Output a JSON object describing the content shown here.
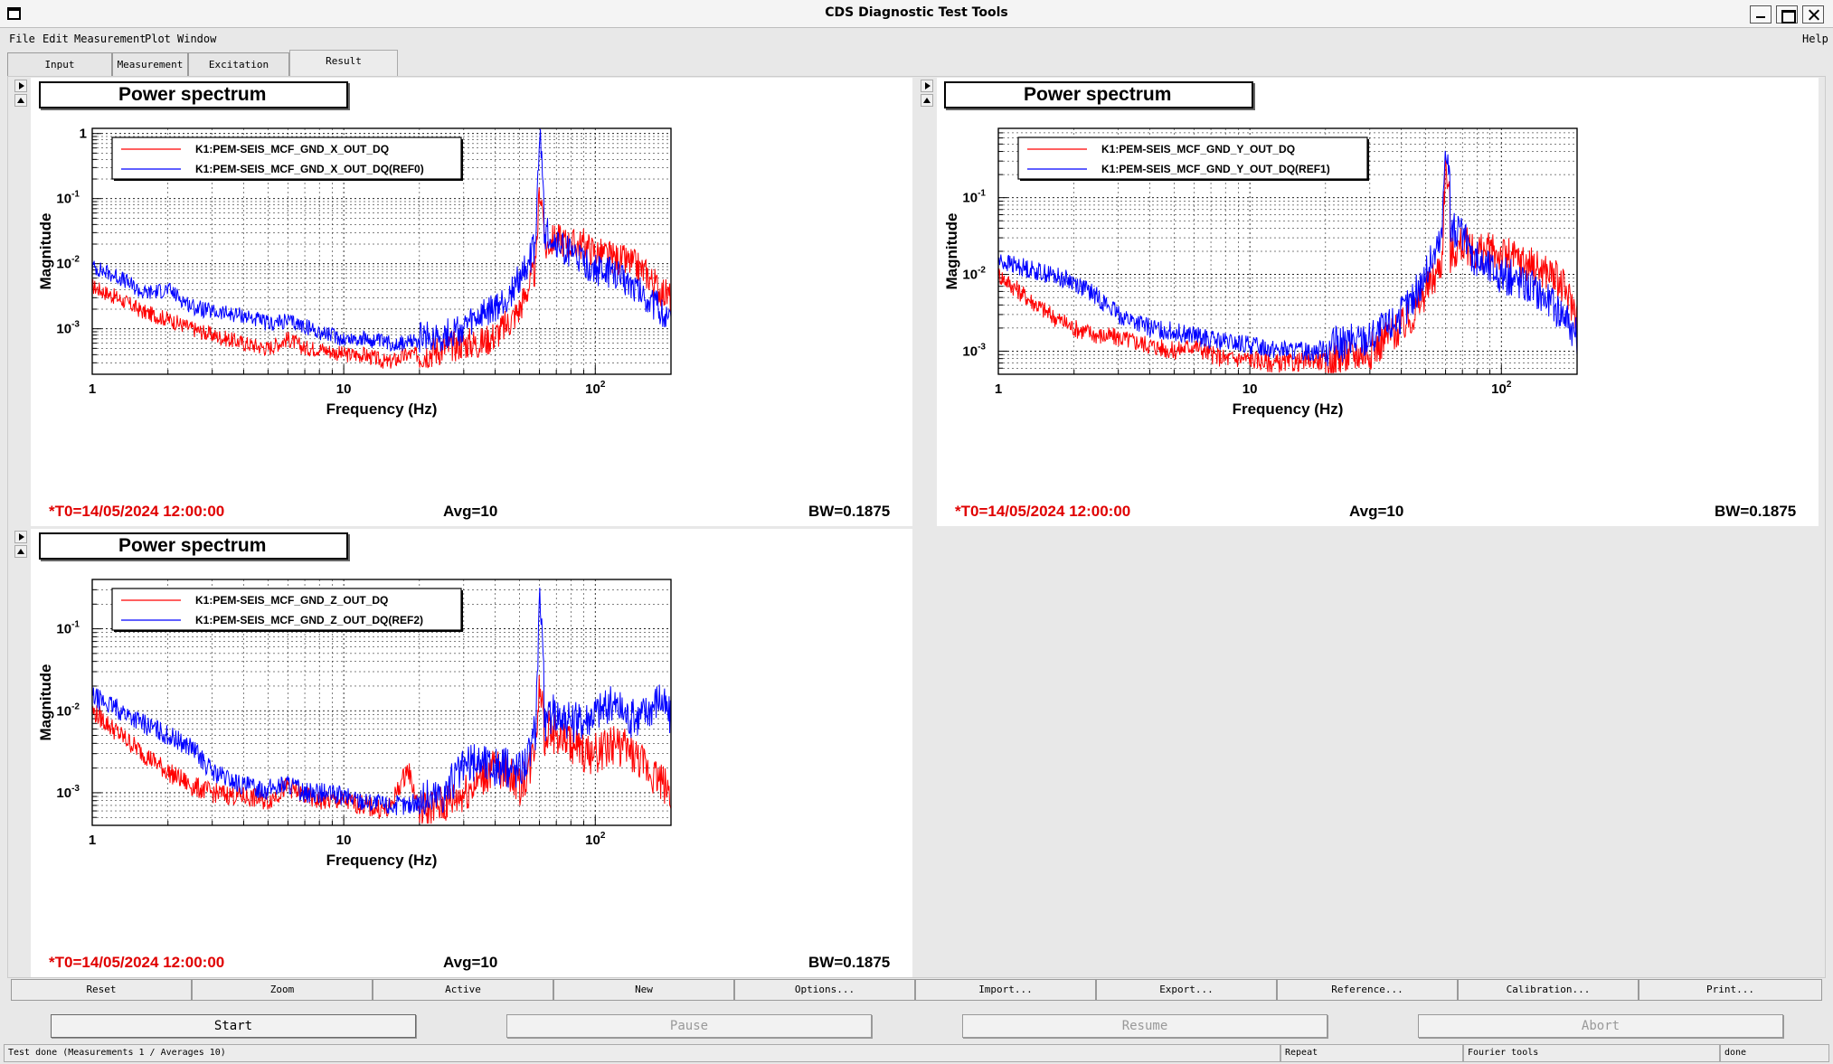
{
  "window": {
    "title": "CDS Diagnostic Test Tools"
  },
  "menubar": {
    "items": [
      {
        "label": "File"
      },
      {
        "label": "Edit"
      },
      {
        "label": "Measurement"
      },
      {
        "label": "Plot"
      },
      {
        "label": "Window"
      }
    ],
    "help": "Help"
  },
  "tabs": [
    {
      "label": "Input"
    },
    {
      "label": "Measurement"
    },
    {
      "label": "Excitation"
    },
    {
      "label": "Result",
      "active": true
    }
  ],
  "panels": [
    {
      "title": "Power spectrum",
      "t0": "*T0=14/05/2024 12:00:00",
      "avg": "Avg=10",
      "bw": "BW=0.1875",
      "legend": [
        "K1:PEM-SEIS_MCF_GND_X_OUT_DQ",
        "K1:PEM-SEIS_MCF_GND_X_OUT_DQ(REF0)"
      ]
    },
    {
      "title": "Power spectrum",
      "t0": "*T0=14/05/2024 12:00:00",
      "avg": "Avg=10",
      "bw": "BW=0.1875",
      "legend": [
        "K1:PEM-SEIS_MCF_GND_Y_OUT_DQ",
        "K1:PEM-SEIS_MCF_GND_Y_OUT_DQ(REF1)"
      ]
    },
    {
      "title": "Power spectrum",
      "t0": "*T0=14/05/2024 12:00:00",
      "avg": "Avg=10",
      "bw": "BW=0.1875",
      "legend": [
        "K1:PEM-SEIS_MCF_GND_Z_OUT_DQ",
        "K1:PEM-SEIS_MCF_GND_Z_OUT_DQ(REF2)"
      ]
    }
  ],
  "chart_data": [
    {
      "type": "line",
      "xlabel": "Frequency (Hz)",
      "ylabel": "Magnitude",
      "xscale": "log",
      "yscale": "log",
      "xlim": [
        1,
        200
      ],
      "ylim": [
        0.0002,
        1.2
      ],
      "xticks": [
        "1",
        "10",
        "10^2"
      ],
      "yticks": [
        "10^-3",
        "10^-2",
        "10^-1",
        "1"
      ],
      "grid": true,
      "legend_position": "top-left",
      "series": [
        {
          "name": "K1:PEM-SEIS_MCF_GND_X_OUT_DQ",
          "color": "#ff0000",
          "x": [
            1,
            1.3,
            1.6,
            2,
            2.5,
            3,
            4,
            5,
            6,
            7,
            8,
            10,
            12,
            15,
            18,
            20,
            25,
            30,
            35,
            40,
            45,
            50,
            55,
            58,
            60,
            65,
            70,
            80,
            90,
            100,
            120,
            140,
            160,
            180,
            200
          ],
          "y": [
            0.0045,
            0.0028,
            0.0018,
            0.0014,
            0.001,
            0.0008,
            0.0006,
            0.0005,
            0.0007,
            0.0005,
            0.0005,
            0.0004,
            0.0004,
            0.0003,
            0.0004,
            0.0004,
            0.0005,
            0.0006,
            0.0006,
            0.0008,
            0.0012,
            0.002,
            0.005,
            0.008,
            0.15,
            0.02,
            0.025,
            0.02,
            0.02,
            0.015,
            0.012,
            0.01,
            0.007,
            0.004,
            0.003
          ]
        },
        {
          "name": "K1:PEM-SEIS_MCF_GND_X_OUT_DQ(REF0)",
          "color": "#0000ff",
          "x": [
            1,
            1.3,
            1.6,
            2,
            2.5,
            3,
            4,
            5,
            6,
            7,
            8,
            10,
            12,
            15,
            18,
            20,
            25,
            30,
            35,
            40,
            45,
            50,
            55,
            58,
            60,
            65,
            70,
            80,
            90,
            100,
            120,
            140,
            160,
            180,
            200
          ],
          "y": [
            0.009,
            0.006,
            0.0035,
            0.004,
            0.0022,
            0.0018,
            0.0016,
            0.0012,
            0.0013,
            0.0011,
            0.0009,
            0.0007,
            0.0007,
            0.0006,
            0.0006,
            0.0007,
            0.0008,
            0.001,
            0.0015,
            0.002,
            0.003,
            0.006,
            0.012,
            0.02,
            1.0,
            0.03,
            0.02,
            0.015,
            0.01,
            0.008,
            0.007,
            0.005,
            0.003,
            0.002,
            0.0012
          ]
        }
      ]
    },
    {
      "type": "line",
      "xlabel": "Frequency (Hz)",
      "ylabel": "Magnitude",
      "xscale": "log",
      "yscale": "log",
      "xlim": [
        1,
        200
      ],
      "ylim": [
        0.0005,
        0.8
      ],
      "xticks": [
        "1",
        "10",
        "10^2"
      ],
      "yticks": [
        "10^-3",
        "10^-2",
        "10^-1"
      ],
      "grid": true,
      "legend_position": "top-left",
      "series": [
        {
          "name": "K1:PEM-SEIS_MCF_GND_Y_OUT_DQ",
          "color": "#ff0000",
          "x": [
            1,
            1.3,
            1.6,
            2,
            2.5,
            3,
            4,
            5,
            6,
            7,
            8,
            10,
            12,
            15,
            18,
            20,
            25,
            30,
            35,
            40,
            45,
            50,
            55,
            58,
            60,
            65,
            70,
            80,
            90,
            100,
            120,
            140,
            160,
            180,
            200
          ],
          "y": [
            0.01,
            0.005,
            0.003,
            0.002,
            0.0016,
            0.0015,
            0.0012,
            0.001,
            0.0012,
            0.0009,
            0.0008,
            0.0008,
            0.0007,
            0.0007,
            0.0008,
            0.0007,
            0.0009,
            0.001,
            0.0015,
            0.002,
            0.003,
            0.006,
            0.01,
            0.015,
            0.3,
            0.02,
            0.025,
            0.02,
            0.02,
            0.018,
            0.015,
            0.012,
            0.01,
            0.006,
            0.003
          ]
        },
        {
          "name": "K1:PEM-SEIS_MCF_GND_Y_OUT_DQ(REF1)",
          "color": "#0000ff",
          "x": [
            1,
            1.3,
            1.6,
            2,
            2.5,
            3,
            4,
            5,
            6,
            7,
            8,
            10,
            12,
            15,
            18,
            20,
            25,
            30,
            35,
            40,
            45,
            50,
            55,
            58,
            60,
            65,
            70,
            80,
            90,
            100,
            120,
            140,
            160,
            180,
            200
          ],
          "y": [
            0.015,
            0.012,
            0.01,
            0.008,
            0.005,
            0.003,
            0.002,
            0.0018,
            0.0016,
            0.0014,
            0.0013,
            0.0012,
            0.0011,
            0.001,
            0.001,
            0.0011,
            0.0013,
            0.0015,
            0.002,
            0.003,
            0.005,
            0.01,
            0.02,
            0.03,
            0.6,
            0.04,
            0.03,
            0.015,
            0.012,
            0.01,
            0.008,
            0.006,
            0.004,
            0.003,
            0.0015
          ]
        }
      ]
    },
    {
      "type": "line",
      "xlabel": "Frequency (Hz)",
      "ylabel": "Magnitude",
      "xscale": "log",
      "yscale": "log",
      "xlim": [
        1,
        200
      ],
      "ylim": [
        0.0004,
        0.4
      ],
      "xticks": [
        "1",
        "10",
        "10^2"
      ],
      "yticks": [
        "10^-3",
        "10^-2",
        "10^-1"
      ],
      "grid": true,
      "legend_position": "top-left",
      "series": [
        {
          "name": "K1:PEM-SEIS_MCF_GND_Z_OUT_DQ",
          "color": "#ff0000",
          "x": [
            1,
            1.3,
            1.6,
            2,
            2.5,
            3,
            4,
            5,
            6,
            7,
            8,
            10,
            12,
            15,
            18,
            20,
            25,
            30,
            35,
            40,
            45,
            50,
            55,
            58,
            60,
            65,
            70,
            80,
            90,
            100,
            120,
            140,
            160,
            180,
            200
          ],
          "y": [
            0.01,
            0.005,
            0.003,
            0.0018,
            0.0012,
            0.001,
            0.0009,
            0.0008,
            0.0012,
            0.0009,
            0.0008,
            0.0008,
            0.0007,
            0.0006,
            0.002,
            0.0006,
            0.0007,
            0.001,
            0.0015,
            0.002,
            0.0018,
            0.0012,
            0.002,
            0.005,
            0.02,
            0.006,
            0.005,
            0.004,
            0.003,
            0.003,
            0.004,
            0.003,
            0.002,
            0.0015,
            0.001
          ]
        },
        {
          "name": "K1:PEM-SEIS_MCF_GND_Z_OUT_DQ(REF2)",
          "color": "#0000ff",
          "x": [
            1,
            1.3,
            1.6,
            2,
            2.5,
            3,
            4,
            5,
            6,
            7,
            8,
            10,
            12,
            15,
            18,
            20,
            25,
            30,
            35,
            40,
            45,
            50,
            55,
            58,
            60,
            65,
            70,
            80,
            90,
            100,
            120,
            140,
            160,
            180,
            200
          ],
          "y": [
            0.015,
            0.01,
            0.007,
            0.005,
            0.0035,
            0.0018,
            0.0012,
            0.0011,
            0.0013,
            0.001,
            0.001,
            0.0009,
            0.0008,
            0.0007,
            0.0007,
            0.0008,
            0.001,
            0.002,
            0.0025,
            0.002,
            0.002,
            0.002,
            0.003,
            0.006,
            0.3,
            0.008,
            0.01,
            0.007,
            0.008,
            0.01,
            0.012,
            0.008,
            0.01,
            0.015,
            0.008
          ]
        }
      ]
    }
  ],
  "toolbar": [
    "Reset",
    "Zoom",
    "Active",
    "New",
    "Options...",
    "Import...",
    "Export...",
    "Reference...",
    "Calibration...",
    "Print..."
  ],
  "actions": [
    {
      "label": "Start",
      "enabled": true
    },
    {
      "label": "Pause",
      "enabled": false
    },
    {
      "label": "Resume",
      "enabled": false
    },
    {
      "label": "Abort",
      "enabled": false
    }
  ],
  "status": {
    "message": "Test done (Measurements 1 / Averages 10)",
    "repeat": "Repeat",
    "tool": "Fourier tools",
    "state": "done"
  }
}
